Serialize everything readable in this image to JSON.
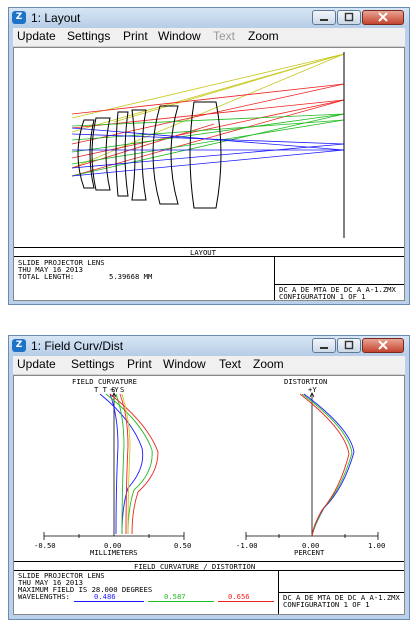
{
  "window1": {
    "title": "1: Layout",
    "menu": [
      {
        "label": "Update",
        "disabled": false
      },
      {
        "label": "Settings",
        "disabled": false
      },
      {
        "label": "Print",
        "disabled": false
      },
      {
        "label": "Window",
        "disabled": false
      },
      {
        "label": "Text",
        "disabled": true
      },
      {
        "label": "Zoom",
        "disabled": false
      }
    ],
    "plot_title": "LAYOUT",
    "lens_name": "SLIDE PROJECTOR LENS",
    "date": "THU MAY 16 2013",
    "total_length_label": "TOTAL LENGTH:",
    "total_length_value": "5.39668 MM",
    "file_info": "DC A DE MTA DE DC A A-1.ZMX",
    "configuration": "CONFIGURATION 1 OF 1"
  },
  "window2": {
    "title": "1: Field Curv/Dist",
    "menu": [
      {
        "label": "Update",
        "disabled": false
      },
      {
        "label": "Settings",
        "disabled": false
      },
      {
        "label": "Print",
        "disabled": false
      },
      {
        "label": "Window",
        "disabled": false
      },
      {
        "label": "Text",
        "disabled": false
      },
      {
        "label": "Zoom",
        "disabled": false
      }
    ],
    "field_curvature_title": "FIELD CURVATURE",
    "distortion_title": "DISTORTION",
    "fc_legend": "T T S S",
    "fc_axis_label": "+Y",
    "dist_axis_label": "+Y",
    "fc_ticks": [
      "-0.50",
      "0.00",
      "0.50"
    ],
    "fc_unit": "MILLIMETERS",
    "dist_ticks": [
      "-1.00",
      "0.00",
      "1.00"
    ],
    "dist_unit": "PERCENT",
    "plot_title": "FIELD CURVATURE / DISTORTION",
    "lens_name": "SLIDE PROJECTOR LENS",
    "date": "THU MAY 16 2013",
    "max_field": "MAXIMUM FIELD IS 28.000 DEGREES",
    "wavelengths_label": "WAVELENGTHS:",
    "wavelengths": [
      {
        "value": "0.486",
        "color": "#1a1aff"
      },
      {
        "value": "0.587",
        "color": "#22bb22"
      },
      {
        "value": "0.656",
        "color": "#ee2222"
      }
    ],
    "file_info": "DC A DE MTA DE DC A A-1.ZMX",
    "configuration": "CONFIGURATION 1 OF 1"
  },
  "colors": {
    "titlebar": "#b9d1ea",
    "close": "#c4442e",
    "blue": "#1a1aff",
    "green": "#22bb22",
    "red": "#ee2222",
    "yellow": "#c8c820"
  },
  "icons": [
    "app-icon",
    "minimize-icon",
    "maximize-icon",
    "close-icon"
  ]
}
